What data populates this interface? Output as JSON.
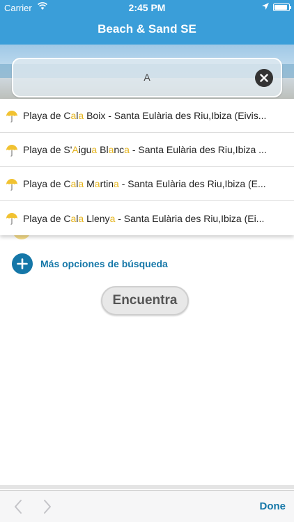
{
  "status_bar": {
    "carrier": "Carrier",
    "time": "2:45 PM",
    "battery_level": 0.9
  },
  "nav": {
    "title": "Beach & Sand SE"
  },
  "search": {
    "query": "A",
    "clear_icon": "clear-icon"
  },
  "suggestions": [
    {
      "parts": [
        [
          "Playa de C",
          false
        ],
        [
          "a",
          true
        ],
        [
          "l",
          false
        ],
        [
          "a",
          true
        ],
        [
          " Boix - Santa Eulària des Riu,Ibiza (Eivis...",
          false
        ]
      ]
    },
    {
      "parts": [
        [
          "Playa de S'",
          false
        ],
        [
          "A",
          true
        ],
        [
          "igu",
          false
        ],
        [
          "a",
          true
        ],
        [
          " Bl",
          false
        ],
        [
          "a",
          true
        ],
        [
          "nc",
          false
        ],
        [
          "a",
          true
        ],
        [
          " - Santa Eulària des Riu,Ibiza ...",
          false
        ]
      ]
    },
    {
      "parts": [
        [
          "Playa de C",
          false
        ],
        [
          "a",
          true
        ],
        [
          "l",
          false
        ],
        [
          "a",
          true
        ],
        [
          " M",
          false
        ],
        [
          "a",
          true
        ],
        [
          "rtin",
          false
        ],
        [
          "a",
          true
        ],
        [
          " - Santa Eulària des Riu,Ibiza (E...",
          false
        ]
      ]
    },
    {
      "parts": [
        [
          "Playa de C",
          false
        ],
        [
          "a",
          true
        ],
        [
          "l",
          false
        ],
        [
          "a",
          true
        ],
        [
          " Lleny",
          false
        ],
        [
          "a",
          true
        ],
        [
          " - Santa Eulària des Riu,Ibiza (Ei...",
          false
        ]
      ]
    }
  ],
  "more_options": {
    "label": "Más opciones de búsqueda"
  },
  "find_button": {
    "label": "Encuentra"
  },
  "toolbar": {
    "done_label": "Done"
  },
  "colors": {
    "nav_blue": "#3a9ed9",
    "accent": "#1577a8",
    "highlight": "#e5b41c"
  }
}
